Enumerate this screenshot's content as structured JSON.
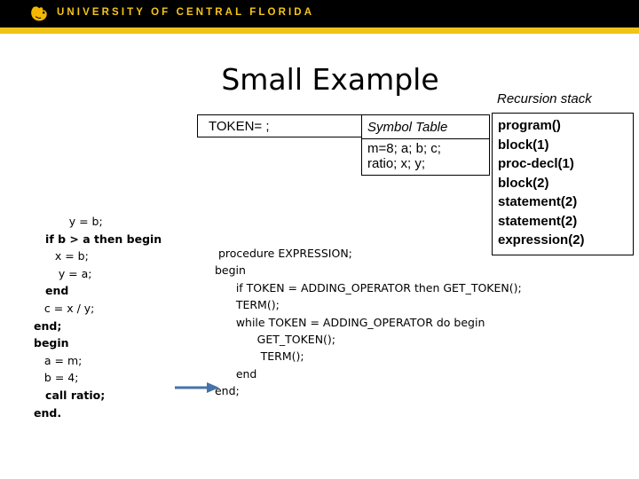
{
  "header": {
    "wordmark": "UNIVERSITY OF CENTRAL FLORIDA",
    "logo_icon": "pegasus-icon",
    "bar_color": "#000000",
    "gold_color": "#f0c419",
    "text_color": "#f5c518"
  },
  "title": "Small Example",
  "recursion_stack": {
    "label": "Recursion stack",
    "frames": [
      "program()",
      "block(1)",
      "proc-decl(1)",
      "block(2)",
      "statement(2)",
      "statement(2)",
      "expression(2)"
    ]
  },
  "token_box": {
    "text": "TOKEN= ;"
  },
  "symbol_table": {
    "header": "Symbol Table",
    "lines": [
      "m=8; a; b; c;",
      "ratio; x; y;"
    ]
  },
  "left_code": {
    "lines": [
      "          y = b;",
      "   if b > a then begin",
      "      x = b;",
      "       y = a;",
      "   end",
      "   c = x / y;",
      "end;",
      "begin",
      "   a = m;",
      "   b = 4;",
      "   call ratio;",
      "end."
    ]
  },
  "middle_code": {
    "lines": [
      "  procedure EXPRESSION;",
      " begin",
      "       if TOKEN = ADDING_OPERATOR then GET_TOKEN();",
      "       TERM();",
      "       while TOKEN = ADDING_OPERATOR do begin",
      "             GET_TOKEN();",
      "              TERM();",
      "       end",
      " end;"
    ]
  },
  "arrow": {
    "icon": "right-arrow-icon",
    "color": "#4573a7"
  }
}
